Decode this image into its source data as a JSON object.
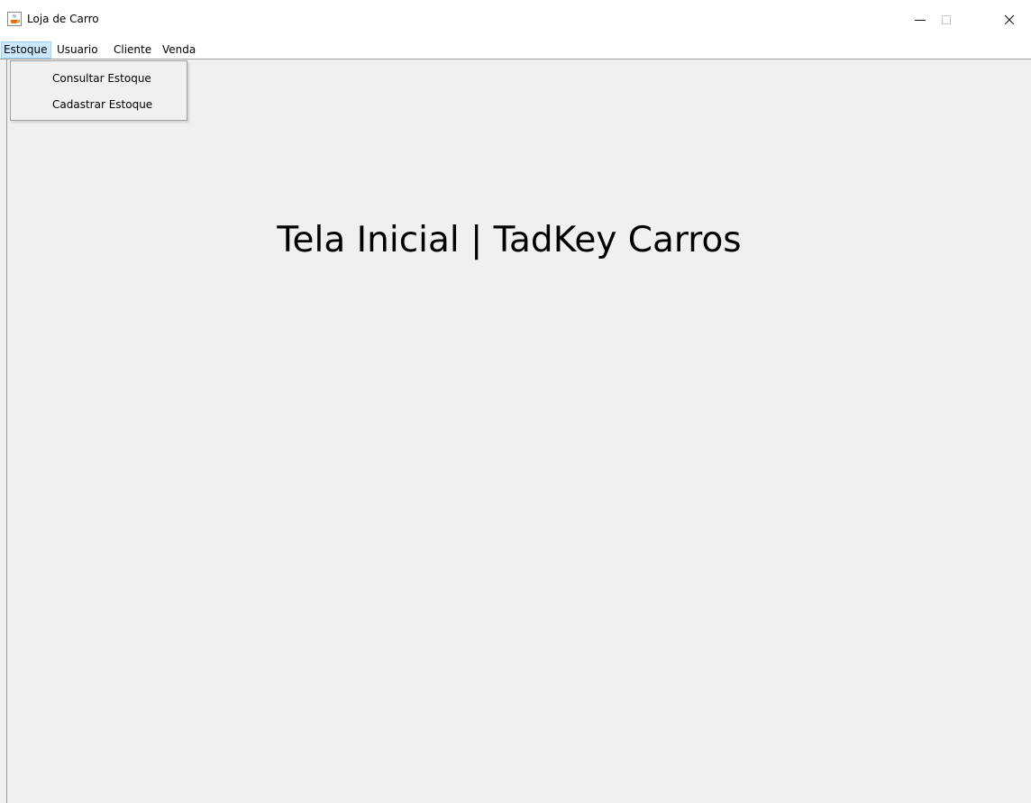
{
  "window": {
    "title": "Loja de Carro",
    "app_icon": "java-cup-icon",
    "controls": {
      "minimize": "minimize-icon",
      "maximize": "maximize-icon",
      "close": "close-icon",
      "close_glyph": "✕"
    }
  },
  "menubar": {
    "items": [
      {
        "label": "Estoque",
        "active": true
      },
      {
        "label": "Usuario",
        "active": false
      },
      {
        "label": "Cliente",
        "active": false
      },
      {
        "label": "Venda",
        "active": false
      }
    ],
    "active_bg": "#cce8ff"
  },
  "dropdown": {
    "items": [
      {
        "label": "Consultar Estoque"
      },
      {
        "label": "Cadastrar Estoque"
      }
    ]
  },
  "main": {
    "heading": "Tela Inicial | TadKey Carros"
  }
}
